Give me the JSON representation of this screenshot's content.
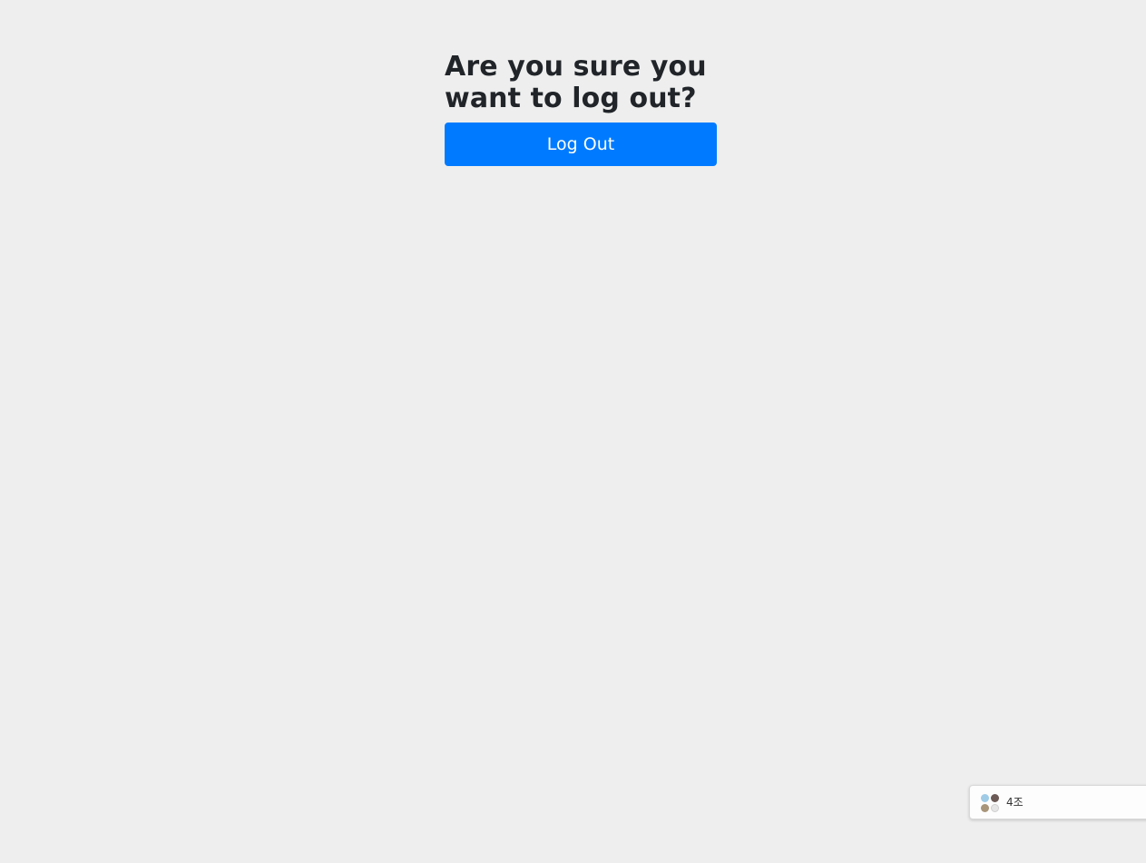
{
  "logout": {
    "title": "Are you sure you want to log out?",
    "button_label": "Log Out",
    "accent_color": "#007bff"
  },
  "chat_widget": {
    "group_name": "4조",
    "avatar_icon": "group-avatar-icon"
  },
  "colors": {
    "background": "#eeeeee",
    "text": "#212529",
    "button_text": "#ffffff"
  }
}
